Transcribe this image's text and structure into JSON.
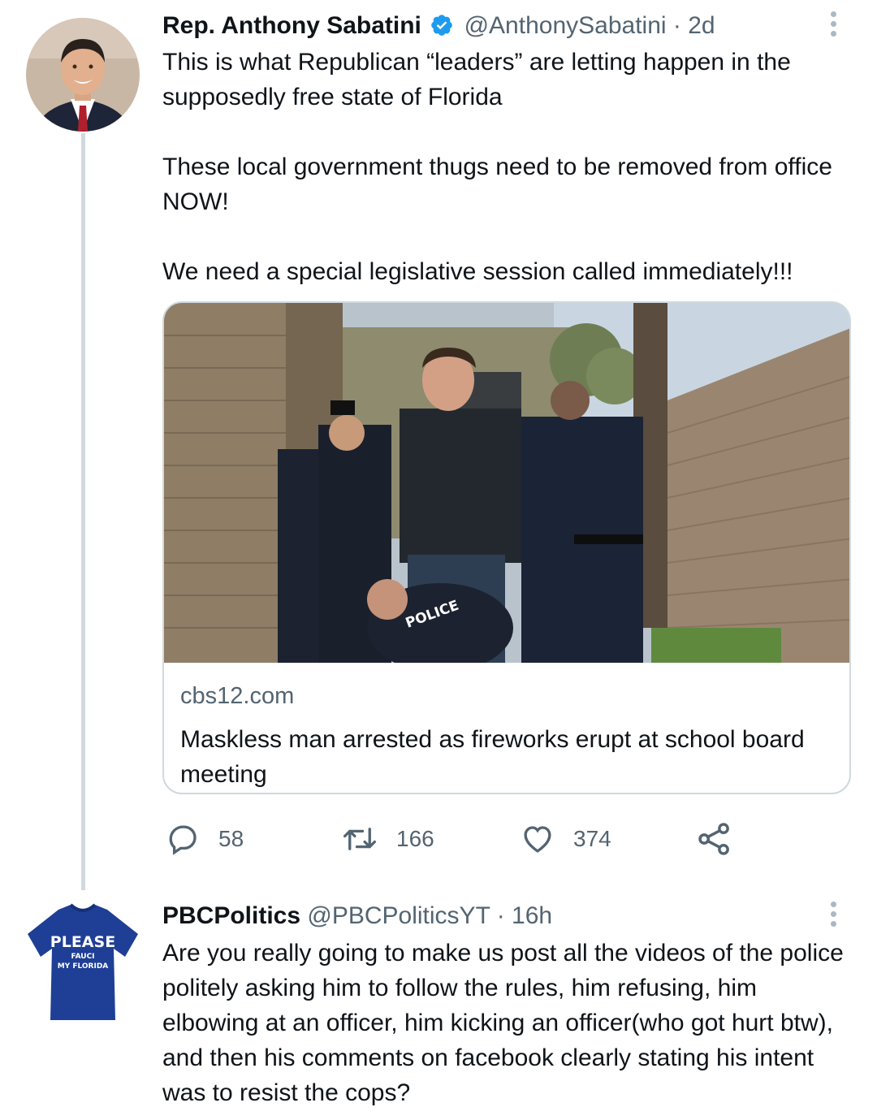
{
  "tweet1": {
    "display_name": "Rep. Anthony Sabatini",
    "handle": "@AnthonySabatini",
    "separator": "·",
    "time": "2d",
    "paragraphs": [
      "This is what Republican “leaders” are letting happen in the supposedly free state of Florida",
      "These local government thugs need to be removed from office NOW!",
      "We need a special legislative session called immediately!!!"
    ],
    "card": {
      "domain": "cbs12.com",
      "title": "Maskless man arrested as fireworks erupt at school board meeting",
      "image_vest_text": "POLICE"
    },
    "actions": {
      "reply_count": "58",
      "retweet_count": "166",
      "like_count": "374"
    }
  },
  "tweet2": {
    "display_name": "PBCPolitics",
    "handle": "@PBCPoliticsYT",
    "separator": "·",
    "time": "16h",
    "avatar_shirt_text": [
      "PLEASE",
      "FAUCI",
      "MY FLORIDA"
    ],
    "text": "Are you really going to make us post all the videos of the police politely asking him to follow the rules, him refusing, him elbowing at an officer, him kicking an officer(who got hurt btw), and then his comments on facebook clearly stating his intent was to resist the cops?"
  },
  "colors": {
    "text_primary": "#0f1419",
    "text_secondary": "#536471",
    "verified_blue": "#1d9bf0",
    "thread_line": "#cfd9de"
  },
  "icons": [
    "verified-badge-icon",
    "more-options-icon",
    "reply-icon",
    "retweet-icon",
    "like-icon",
    "share-icon"
  ]
}
